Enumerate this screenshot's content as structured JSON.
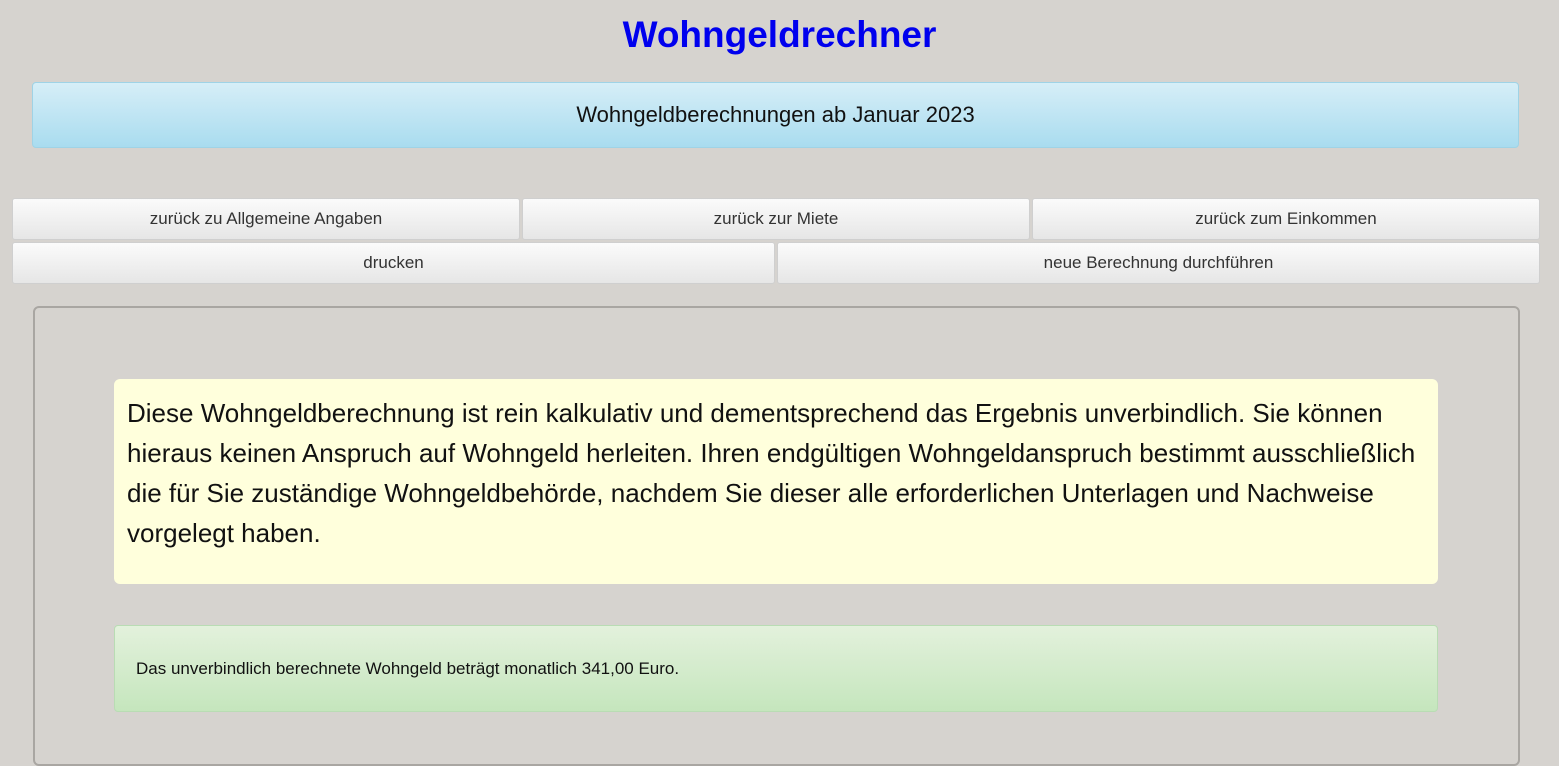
{
  "page": {
    "title": "Wohngeldrechner",
    "banner": "Wohngeldberechnungen ab Januar 2023"
  },
  "nav": {
    "row1": [
      {
        "label": "zurück zu Allgemeine Angaben"
      },
      {
        "label": "zurück zur Miete"
      },
      {
        "label": "zurück zum Einkommen"
      }
    ],
    "row2": [
      {
        "label": "drucken"
      },
      {
        "label": "neue Berechnung durchführen"
      }
    ]
  },
  "main": {
    "disclaimer": "Diese Wohngeldberechnung ist rein kalkulativ und dementsprechend das Ergebnis unverbindlich. Sie können hieraus keinen Anspruch auf Wohngeld herleiten. Ihren endgültigen Wohngeldanspruch bestimmt ausschließlich die für Sie zuständige Wohngeldbehörde, nachdem Sie dieser alle erforderlichen Unterlagen und Nachweise vorgelegt haben.",
    "result": "Das unverbindlich berechnete Wohngeld beträgt monatlich 341,00 Euro."
  },
  "colors": {
    "title": "#0000ee",
    "background": "#d6d3cf",
    "banner": "#a9dcef",
    "disclaimer_background": "#ffffdc",
    "result_background": "#c5e6bd"
  }
}
